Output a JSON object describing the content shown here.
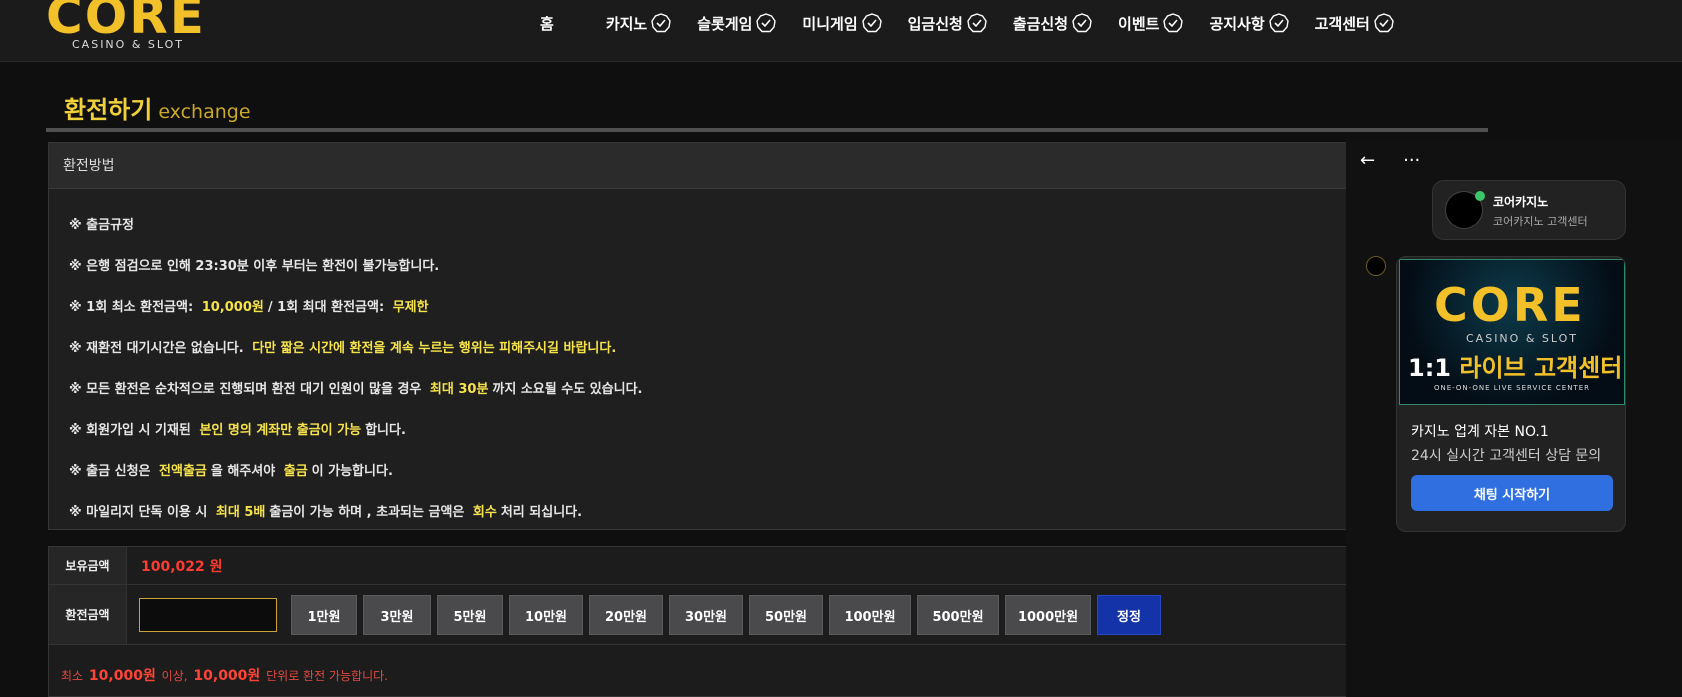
{
  "brand": {
    "logo_word": "CORE",
    "logo_sub": "CASINO & SLOT",
    "gold": "#f2c029"
  },
  "nav": [
    {
      "label": "홈",
      "check": false
    },
    {
      "label": "카지노",
      "check": true
    },
    {
      "label": "슬롯게임",
      "check": true
    },
    {
      "label": "미니게임",
      "check": true
    },
    {
      "label": "입금신청",
      "check": true
    },
    {
      "label": "출금신청",
      "check": true
    },
    {
      "label": "이벤트",
      "check": true
    },
    {
      "label": "공지사항",
      "check": true
    },
    {
      "label": "고객센터",
      "check": true
    }
  ],
  "page": {
    "title": "환전하기",
    "title_en": "exchange"
  },
  "method": {
    "heading": "환전방법",
    "rules": [
      {
        "parts": [
          {
            "t": "※ 출금규정"
          }
        ]
      },
      {
        "parts": [
          {
            "t": "※ 은행 점검으로 인해 23:30분 이후 부터는 환전이 불가능합니다."
          }
        ]
      },
      {
        "parts": [
          {
            "t": "※ 1회 최소 환전금액:"
          },
          {
            "t": "10,000원",
            "hl": true
          },
          {
            "t": "/ 1회 최대 환전금액:"
          },
          {
            "t": "무제한",
            "hl": true
          }
        ]
      },
      {
        "parts": [
          {
            "t": "※ 재환전 대기시간은 없습니다."
          },
          {
            "t": "다만 짧은 시간에 환전을 계속 누르는 행위는 피해주시길 바랍니다.",
            "hl": true
          }
        ]
      },
      {
        "parts": [
          {
            "t": "※ 모든 환전은 순차적으로 진행되며 환전 대기 인원이 많을 경우"
          },
          {
            "t": "최대 30분",
            "hl": true
          },
          {
            "t": "까지 소요될 수도 있습니다."
          }
        ]
      },
      {
        "parts": [
          {
            "t": "※ 회원가입 시 기재된"
          },
          {
            "t": "본인 명의 계좌만 출금이 가능",
            "hl": true
          },
          {
            "t": "합니다."
          }
        ]
      },
      {
        "parts": [
          {
            "t": "※ 출금 신청은"
          },
          {
            "t": "전액출금",
            "hl": true
          },
          {
            "t": "을 해주셔야"
          },
          {
            "t": "출금",
            "hl": true
          },
          {
            "t": "이 가능합니다."
          }
        ]
      },
      {
        "parts": [
          {
            "t": "※ 마일리지 단독 이용 시"
          },
          {
            "t": "최대 5배",
            "hl": true
          },
          {
            "t": "출금이 가능 하며 , 초과되는 금액은"
          },
          {
            "t": "회수",
            "hl": true
          },
          {
            "t": "처리 되십니다."
          }
        ]
      }
    ]
  },
  "balance": {
    "label": "보유금액",
    "value": "100,022 원"
  },
  "amount": {
    "label": "환전금액",
    "value": "",
    "buttons": [
      "1만원",
      "3만원",
      "5만원",
      "10만원",
      "20만원",
      "30만원",
      "50만원",
      "100만원",
      "500만원",
      "1000만원"
    ],
    "reset": "정정"
  },
  "note": {
    "p1": "최소",
    "v1": "10,000원",
    "p2": "이상,",
    "v2": "10,000원",
    "p3": "단위로 환전 가능합니다."
  },
  "chat": {
    "back": "←",
    "more": "···",
    "profile_name": "코어카지노",
    "profile_sub": "코어카지노 고객센터",
    "banner_word": "CORE",
    "banner_sub": "CASINO & SLOT",
    "banner_title_a": "1:1",
    "banner_title_b": "라이브 고객센터",
    "banner_small": "ONE-ON-ONE LIVE SERVICE CENTER",
    "line1": "카지노 업계 자본 NO.1",
    "line2": "24시 실시간 고객센터 상담 문의",
    "start": "채팅 시작하기"
  }
}
